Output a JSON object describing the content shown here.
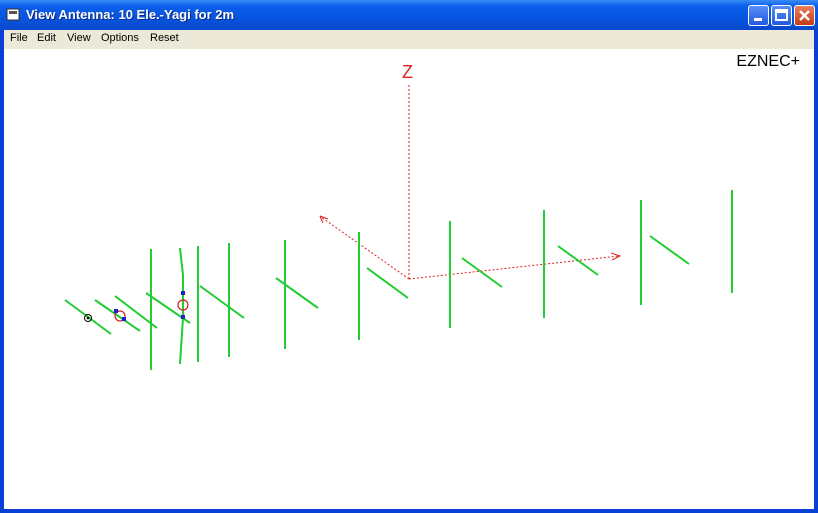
{
  "window": {
    "title": "View Antenna: 10 Ele.-Yagi for 2m"
  },
  "menu": {
    "items": [
      "File",
      "Edit",
      "View",
      "Options",
      "Reset"
    ]
  },
  "brand": "EZNEC+",
  "axes": {
    "z_label": "Z",
    "axis_color": "#E02020"
  },
  "colors": {
    "element": "#22CC33",
    "source": "#2020CC",
    "load": "#D02020"
  },
  "icons": [
    "app-icon",
    "minimize-icon",
    "maximize-icon",
    "close-icon",
    "source-marker-icon",
    "load-marker-icon"
  ]
}
